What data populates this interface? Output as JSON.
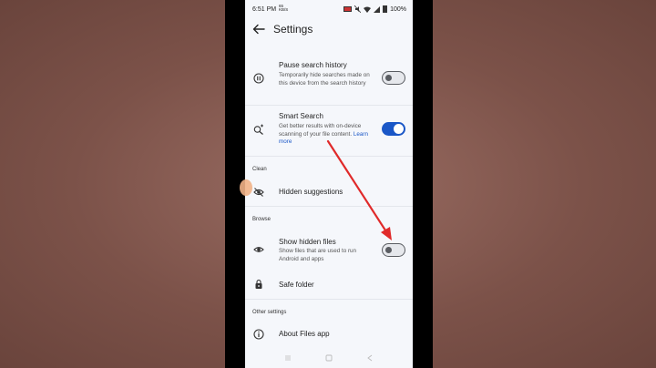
{
  "status": {
    "time": "6:51",
    "ampm": "PM",
    "tiny_top": "65",
    "tiny_bottom": "KB/S",
    "battery": "100%"
  },
  "appbar": {
    "title": "Settings"
  },
  "rows": {
    "pause": {
      "title": "Pause search history",
      "subtitle": "Temporarily hide searches made on this device from the search history",
      "toggle": "off"
    },
    "smart": {
      "title": "Smart Search",
      "subtitle": "Get better results with on-device scanning of your file content.",
      "link": "Learn more",
      "toggle": "on"
    },
    "clean_section": "Clean",
    "hidden_suggestions": {
      "title": "Hidden suggestions"
    },
    "browse_section": "Browse",
    "show_hidden": {
      "title": "Show hidden files",
      "subtitle": "Show files that are used to run Android and apps",
      "toggle": "off"
    },
    "safe_folder": {
      "title": "Safe folder"
    },
    "other_section": "Other settings",
    "about": {
      "title": "About Files app"
    }
  },
  "icons": {
    "pause": "pause-circle-icon",
    "smart": "sparkle-search-icon",
    "hidden": "eye-off-icon",
    "show_hidden": "eye-icon",
    "safe": "lock-icon",
    "about": "info-icon",
    "back": "arrow-back-icon"
  },
  "colors": {
    "accent": "#1a57c7",
    "annotation_arrow": "#e02a2a",
    "background": "#f5f7fb"
  }
}
